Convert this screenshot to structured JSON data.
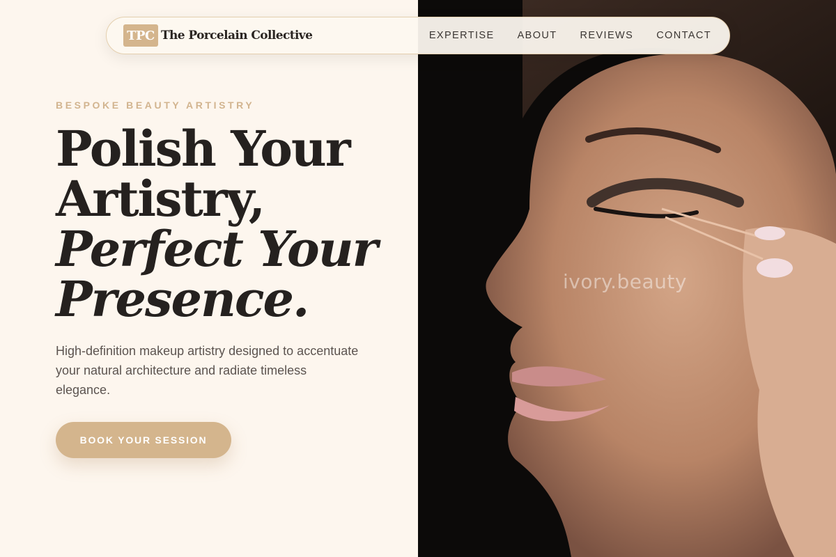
{
  "brand": {
    "logo_text": "TPC",
    "name": "The Porcelain Collective"
  },
  "nav": {
    "links": [
      "EXPERTISE",
      "ABOUT",
      "REVIEWS",
      "CONTACT"
    ]
  },
  "hero": {
    "eyebrow": "BESPOKE BEAUTY ARTISTRY",
    "headline_line1": "Polish Your",
    "headline_line2": "Artistry,",
    "headline_line3": "Perfect Your",
    "headline_line4": "Presence.",
    "subtext": "High-definition makeup artistry designed to accentuate your natural architecture and radiate timeless elegance.",
    "cta_label": "BOOK YOUR SESSION"
  },
  "photo": {
    "watermark": "ivory.beauty"
  },
  "colors": {
    "accent": "#d4b58d",
    "background": "#fdf6ee",
    "text": "#25211f"
  }
}
